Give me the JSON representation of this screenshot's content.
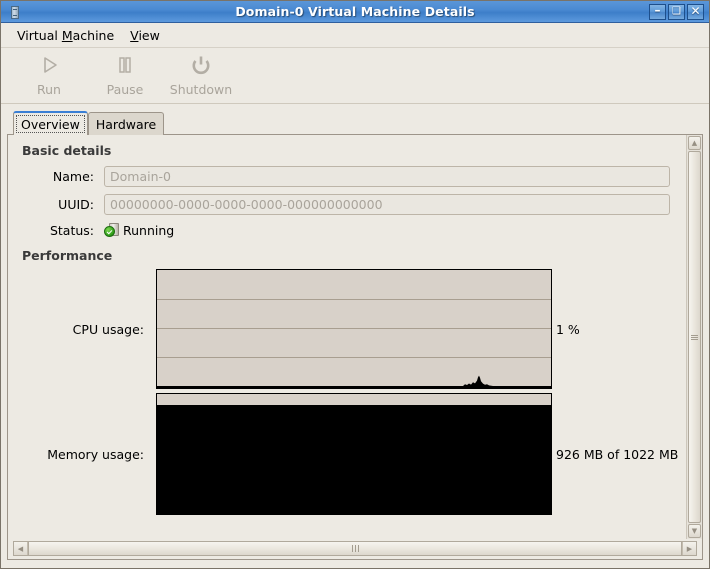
{
  "window": {
    "title": "Domain-0 Virtual Machine Details",
    "icon": "computer-tower-icon",
    "buttons": {
      "minimize": "–",
      "maximize": "❑",
      "close": "✕"
    }
  },
  "menubar": {
    "items": [
      {
        "label": "Virtual Machine",
        "prefix": "Virtual ",
        "mnemonic": "M",
        "suffix": "achine"
      },
      {
        "label": "View",
        "prefix": "",
        "mnemonic": "V",
        "suffix": "iew"
      }
    ]
  },
  "toolbar": {
    "buttons": [
      {
        "label": "Run",
        "icon": "play-icon",
        "enabled": false
      },
      {
        "label": "Pause",
        "icon": "pause-icon",
        "enabled": false
      },
      {
        "label": "Shutdown",
        "icon": "power-icon",
        "enabled": false
      }
    ]
  },
  "tabs": [
    {
      "label": "Overview",
      "active": true
    },
    {
      "label": "Hardware",
      "active": false
    }
  ],
  "basic_details": {
    "heading": "Basic details",
    "name": {
      "label": "Name:",
      "value": "Domain-0"
    },
    "uuid": {
      "label": "UUID:",
      "value": "00000000-0000-0000-0000-000000000000"
    },
    "status": {
      "label": "Status:",
      "value": "Running",
      "icon": "running-check-icon"
    }
  },
  "performance": {
    "heading": "Performance",
    "cpu": {
      "label": "CPU usage:",
      "value": "1 %"
    },
    "memory": {
      "label": "Memory usage:",
      "value": "926 MB of 1022 MB"
    }
  },
  "chart_data": [
    {
      "type": "area",
      "title": "CPU usage",
      "ylabel": "%",
      "ylim": [
        0,
        100
      ],
      "gridlines": 3,
      "current_value": 1,
      "current_label": "1 %",
      "x": [
        0,
        10,
        20,
        30,
        40,
        50,
        60,
        70,
        75,
        78,
        80,
        82,
        84,
        86,
        88,
        90,
        92,
        95,
        100
      ],
      "values": [
        0,
        0,
        0,
        0,
        0,
        0,
        0,
        0,
        0,
        1,
        2,
        3,
        6,
        9,
        5,
        3,
        2,
        1,
        1
      ],
      "fill_color": "#000000",
      "background": "#d8d1c9"
    },
    {
      "type": "area",
      "title": "Memory usage",
      "ylabel": "MB",
      "ylim": [
        0,
        1022
      ],
      "current_value": 926,
      "current_label": "926 MB of 1022 MB",
      "x": [
        0,
        25,
        50,
        75,
        100
      ],
      "values": [
        926,
        926,
        926,
        926,
        926
      ],
      "fill_color": "#000000",
      "background": "#d8d1c9"
    }
  ],
  "scrollbars": {
    "vertical": {
      "up": "▲",
      "down": "▼"
    },
    "horizontal": {
      "left": "◀",
      "right": "▶"
    }
  }
}
